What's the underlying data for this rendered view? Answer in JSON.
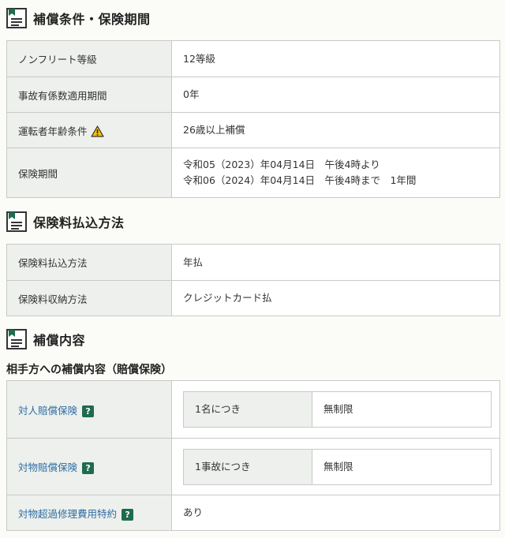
{
  "sections": {
    "terms": {
      "title": "補償条件・保険期間"
    },
    "payment": {
      "title": "保険料払込方法"
    },
    "coverage": {
      "title": "補償内容"
    }
  },
  "terms_rows": [
    {
      "label": "ノンフリート等級",
      "value": "12等級"
    },
    {
      "label": "事故有係数適用期間",
      "value": "0年"
    },
    {
      "label": "運転者年齢条件",
      "value": "26歳以上補償"
    },
    {
      "label": "保険期間",
      "value_line1": "令和05（2023）年04月14日　午後4時より",
      "value_line2": "令和06（2024）年04月14日　午後4時まで　1年間"
    }
  ],
  "payment_rows": [
    {
      "label": "保険料払込方法",
      "value": "年払"
    },
    {
      "label": "保険料収納方法",
      "value": "クレジットカード払"
    }
  ],
  "coverage": {
    "subheading": "相手方への補償内容（賠償保険）",
    "rows": [
      {
        "label": "対人賠償保険",
        "inner_key": "1名につき",
        "inner_value": "無制限"
      },
      {
        "label": "対物賠償保険",
        "inner_key": "1事故につき",
        "inner_value": "無制限"
      },
      {
        "label": "対物超過修理費用特約",
        "value": "あり"
      }
    ],
    "help_glyph": "?"
  },
  "icons": {
    "section": "document-icon",
    "warning": "warning-icon",
    "help": "help-icon"
  },
  "colors": {
    "icon_green": "#1f6b4f",
    "link_blue": "#2e6da4",
    "label_bg": "#edf0ec",
    "warning_yellow": "#f2c200"
  }
}
